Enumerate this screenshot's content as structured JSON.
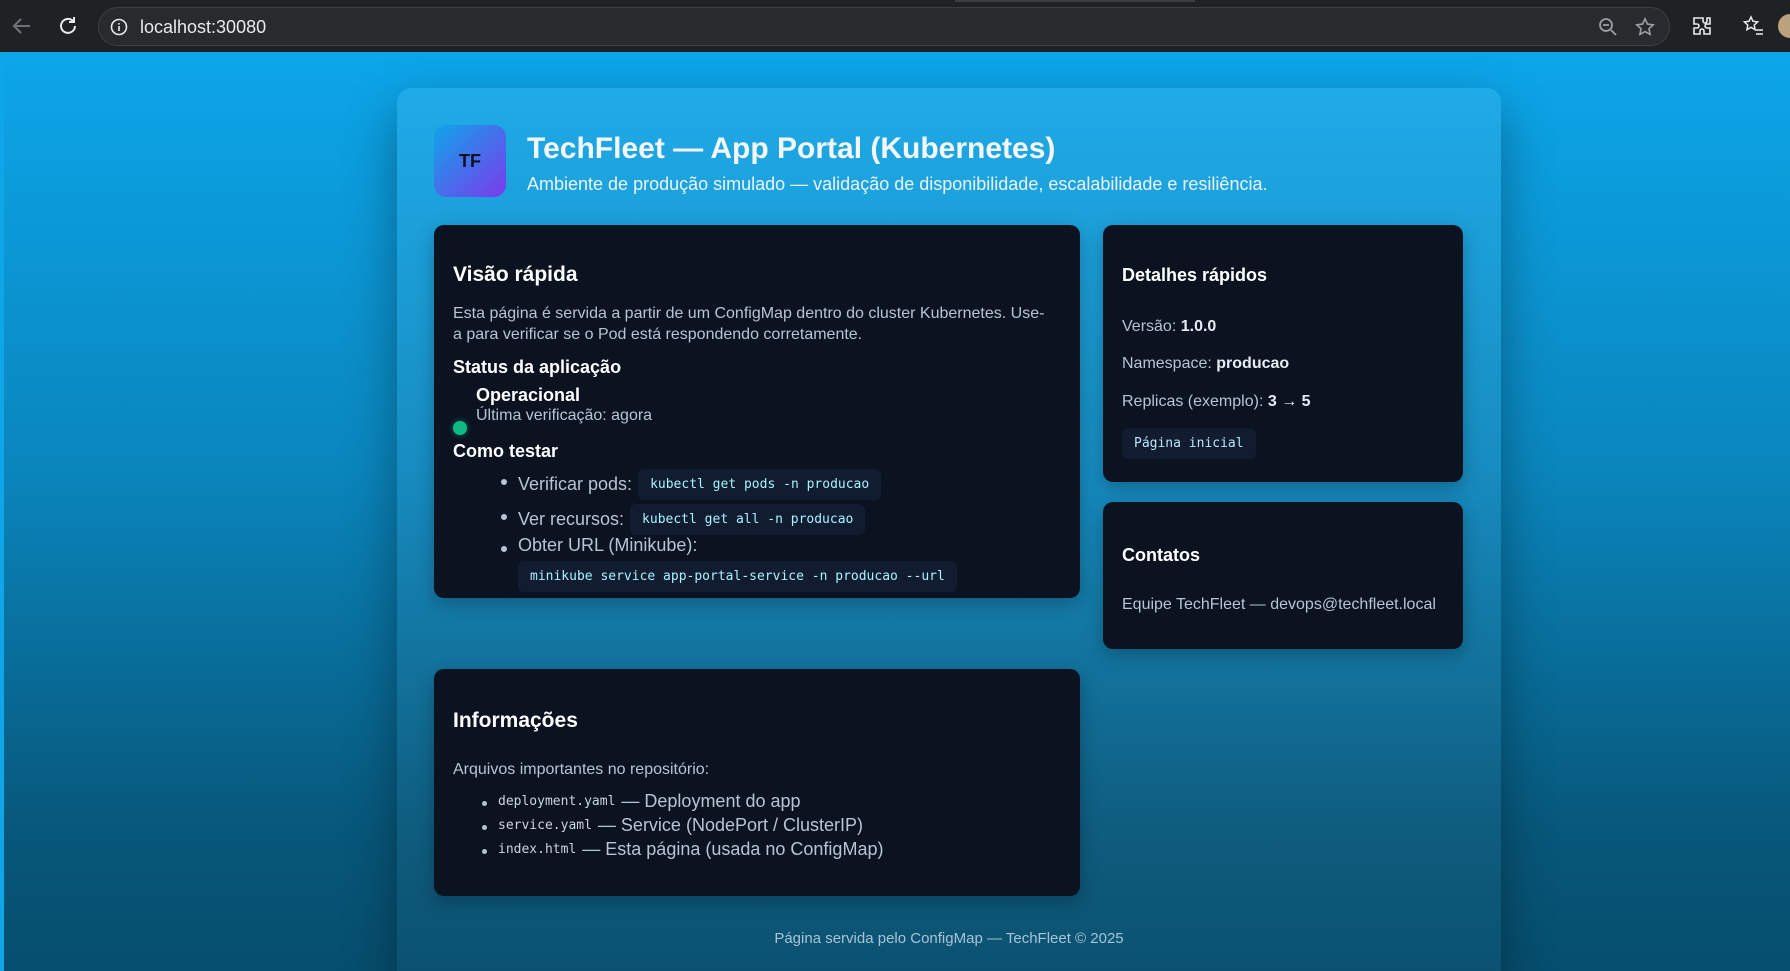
{
  "browser": {
    "url": "localhost:30080"
  },
  "header": {
    "logo_text": "TF",
    "title": "TechFleet — App Portal (Kubernetes)",
    "subtitle": "Ambiente de produção simulado — validação de disponibilidade, escalabilidade e resiliência."
  },
  "overview": {
    "heading": "Visão rápida",
    "description": "Esta página é servida a partir de um ConfigMap dentro do cluster Kubernetes. Use-a para verificar se o Pod está respondendo corretamente.",
    "status_heading": "Status da aplicação",
    "status_label": "Operacional",
    "status_color": "#10b981",
    "last_check": "Última verificação: agora",
    "test_heading": "Como testar",
    "tests": [
      {
        "label": "Verificar pods:",
        "command": "kubectl get pods -n producao"
      },
      {
        "label": "Ver recursos:",
        "command": "kubectl get all -n producao"
      },
      {
        "label": "Obter URL (Minikube):",
        "command": "minikube service app-portal-service -n producao --url"
      }
    ]
  },
  "details": {
    "heading": "Detalhes rápidos",
    "version_label": "Versão:",
    "version_value": "1.0.0",
    "namespace_label": "Namespace:",
    "namespace_value": "producao",
    "replicas_label": "Replicas (exemplo):",
    "replicas_value": "3 → 5",
    "home_link": "Página inicial"
  },
  "contacts": {
    "heading": "Contatos",
    "text": "Equipe TechFleet — devops@techfleet.local"
  },
  "info": {
    "heading": "Informações",
    "intro": "Arquivos importantes no repositório:",
    "files": [
      {
        "file": "deployment.yaml",
        "desc": "— Deployment do app"
      },
      {
        "file": "service.yaml",
        "desc": "— Service (NodePort / ClusterIP)"
      },
      {
        "file": "index.html",
        "desc": "— Esta página (usada no ConfigMap)"
      }
    ]
  },
  "footer": {
    "text": "Página servida pelo ConfigMap — TechFleet © 2025"
  }
}
